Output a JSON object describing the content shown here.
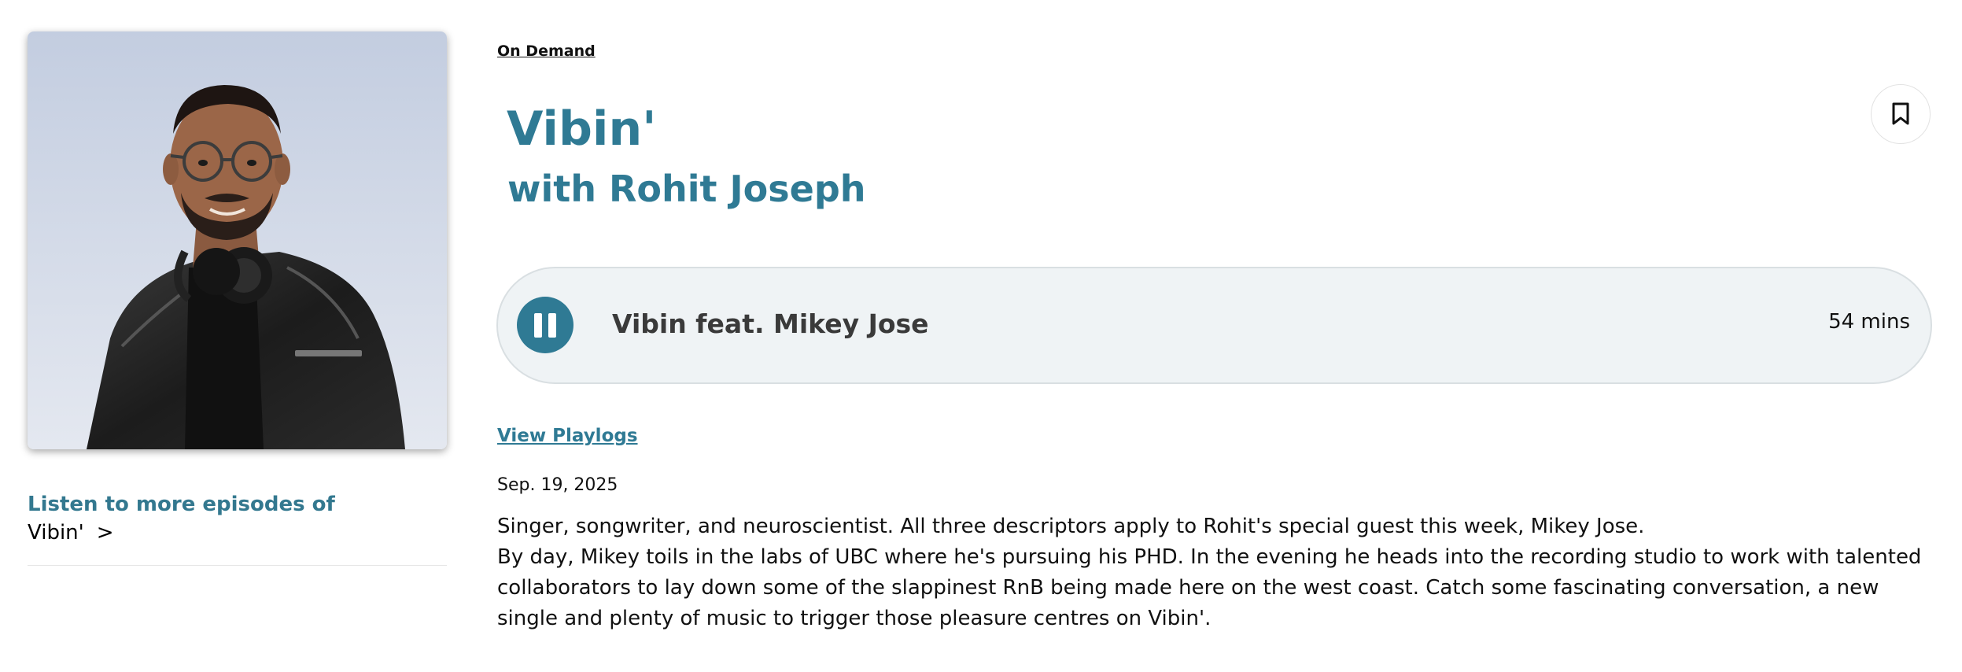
{
  "left": {
    "photo_alt": "Rohit Joseph",
    "more_heading": "Listen to more episodes of",
    "more_link": "Vibin'",
    "more_chevron": ">"
  },
  "breadcrumb": "On Demand",
  "show": {
    "title": "Vibin'",
    "subtitle": "with Rohit Joseph"
  },
  "bookmark_icon": "bookmark-icon",
  "player": {
    "state_icon": "pause-icon",
    "track_title": "Vibin feat. Mikey Jose",
    "duration": "54 mins"
  },
  "view_playlogs": "View Playlogs",
  "episode": {
    "date": "Sep. 19, 2025",
    "description": [
      "Singer, songwriter, and neuroscientist. All three descriptors apply to Rohit's special guest this week, Mikey Jose.",
      "By day, Mikey toils in the labs of UBC where he's pursuing his PHD. In the evening he heads into the recording studio to work with talented collaborators to lay down some of the slappinest RnB being made here on the west coast. Catch some fascinating conversation, a new single and plenty of music to trigger those pleasure centres on Vibin'."
    ]
  },
  "colors": {
    "accent": "#2f7a94",
    "player_bg": "#eff3f5"
  }
}
